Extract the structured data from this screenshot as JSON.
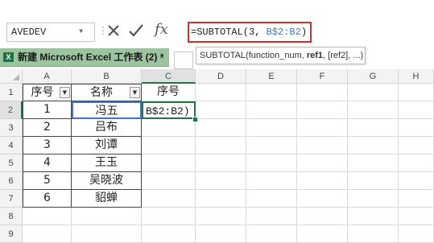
{
  "formula_bar": {
    "name_box": "AVEDEV",
    "name_box_dropdown": "▼",
    "grip": "⋮",
    "fx": "fx",
    "formula_prefix": "=SUBTOTAL(3, ",
    "formula_ref": "B$2:B2",
    "formula_suffix": ")",
    "cancel_icon": "close-x",
    "enter_icon": "checkmark"
  },
  "window_tab": {
    "icon": "X",
    "label": "新建 Microsoft Excel 工作表 (2) *",
    "close": "×"
  },
  "tooltip": {
    "func": "SUBTOTAL(function_num, ",
    "bold_arg": "ref1",
    "rest": ", [ref2], ...)"
  },
  "columns": [
    "A",
    "B",
    "C",
    "D",
    "E",
    "F",
    "G",
    "H"
  ],
  "selected_column": "C",
  "rows": [
    "1",
    "2",
    "3",
    "4",
    "5",
    "6",
    "7",
    "8",
    "9"
  ],
  "selected_row": "2",
  "table": {
    "headers": [
      "序号",
      "名称",
      "序号"
    ],
    "A": [
      "1",
      "2",
      "3",
      "4",
      "5",
      "6"
    ],
    "B": [
      "冯五",
      "吕布",
      "刘谭",
      "王玉",
      "吴晓波",
      "貂蝉"
    ],
    "C2": "B$2:B2)"
  },
  "colors": {
    "accent_green": "#217346",
    "ref_blue": "#4472c4",
    "formula_border_red": "#d0312d",
    "tab_green": "#9cc49f"
  }
}
